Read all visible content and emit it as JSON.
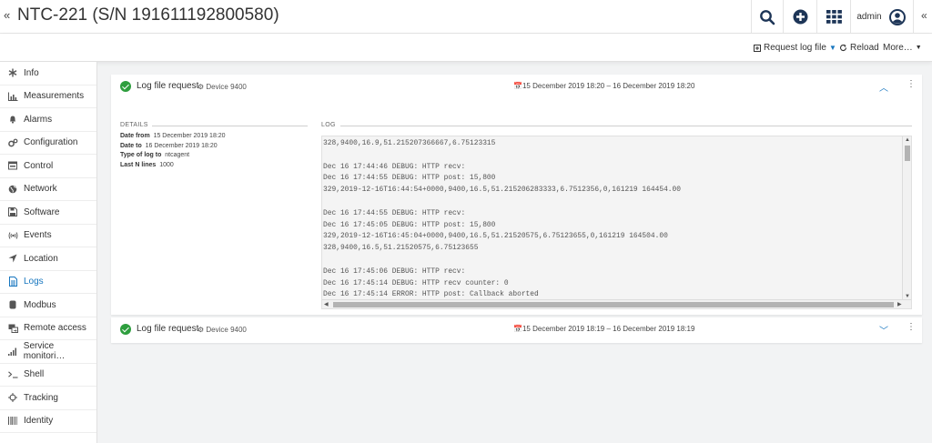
{
  "header": {
    "title": "NTC-221 (S/N 191611192800580)",
    "user": "admin"
  },
  "actions": {
    "request_log": "Request log file",
    "reload": "Reload",
    "more": "More…"
  },
  "sidebar": {
    "items": [
      {
        "label": "Info",
        "icon": "asterisk-icon"
      },
      {
        "label": "Measurements",
        "icon": "bar-chart-icon"
      },
      {
        "label": "Alarms",
        "icon": "bell-icon"
      },
      {
        "label": "Configuration",
        "icon": "gears-icon"
      },
      {
        "label": "Control",
        "icon": "control-icon"
      },
      {
        "label": "Network",
        "icon": "globe-icon"
      },
      {
        "label": "Software",
        "icon": "floppy-icon"
      },
      {
        "label": "Events",
        "icon": "broadcast-icon"
      },
      {
        "label": "Location",
        "icon": "location-arrow-icon"
      },
      {
        "label": "Logs",
        "icon": "document-icon"
      },
      {
        "label": "Modbus",
        "icon": "cylinder-icon"
      },
      {
        "label": "Remote access",
        "icon": "remote-icon"
      },
      {
        "label": "Service monitori…",
        "icon": "signal-icon"
      },
      {
        "label": "Shell",
        "icon": "terminal-icon"
      },
      {
        "label": "Tracking",
        "icon": "crosshair-icon"
      },
      {
        "label": "Identity",
        "icon": "barcode-icon"
      }
    ],
    "active": "Logs"
  },
  "log_request_1": {
    "title": "Log file request",
    "device": "Device 9400",
    "date_range": "15 December 2019 18:20 – 16 December 2019 18:20",
    "details_label": "DETAILS",
    "log_label": "LOG",
    "details": {
      "date_from_label": "Date from",
      "date_from": "15 December 2019 18:20",
      "date_to_label": "Date to",
      "date_to": "16 December 2019 18:20",
      "type_label": "Type of log to",
      "type": "ntcagent",
      "lines_label": "Last N lines",
      "lines": "1000"
    },
    "log_text": "328,9400,16.9,51.215207366667,6.75123315\n\nDec 16 17:44:46 DEBUG: HTTP recv:\nDec 16 17:44:55 DEBUG: HTTP post: 15,800\n329,2019-12-16T16:44:54+0000,9400,16.5,51.215206283333,6.7512356,0,161219 164454.00\n\nDec 16 17:44:55 DEBUG: HTTP recv:\nDec 16 17:45:05 DEBUG: HTTP post: 15,800\n329,2019-12-16T16:45:04+0000,9400,16.5,51.21520575,6.75123655,0,161219 164504.00\n328,9400,16.5,51.21520575,6.75123655\n\nDec 16 17:45:06 DEBUG: HTTP recv:\nDec 16 17:45:14 DEBUG: HTTP recv counter: 0\nDec 16 17:45:14 ERROR: HTTP post: Callback aborted"
  },
  "log_request_2": {
    "title": "Log file request",
    "device": "Device 9400",
    "date_range": "15 December 2019 18:19 – 16 December 2019 18:19"
  },
  "colors": {
    "accent": "#1776bf",
    "success": "#2e9e3e"
  }
}
